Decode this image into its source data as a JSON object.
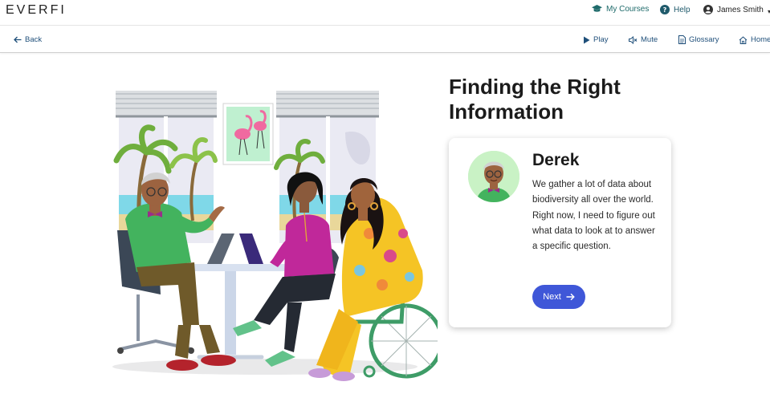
{
  "header": {
    "logo_text": "EVERFI",
    "my_courses_label": "My Courses",
    "help_label": "Help",
    "user_name": "James Smith",
    "accent_color": "#1f6b6b"
  },
  "subnav": {
    "back_label": "Back",
    "play_label": "Play",
    "mute_label": "Mute",
    "glossary_label": "Glossary",
    "home_label": "Home"
  },
  "main": {
    "title": "Finding the Right Information",
    "card": {
      "speaker_name": "Derek",
      "dialog_text": "We gather a lot of data about biodiversity all over the world. Right now, I need to figure out what data to look at to answer a specific question.",
      "next_label": "Next",
      "button_color": "#3f57d8"
    }
  }
}
